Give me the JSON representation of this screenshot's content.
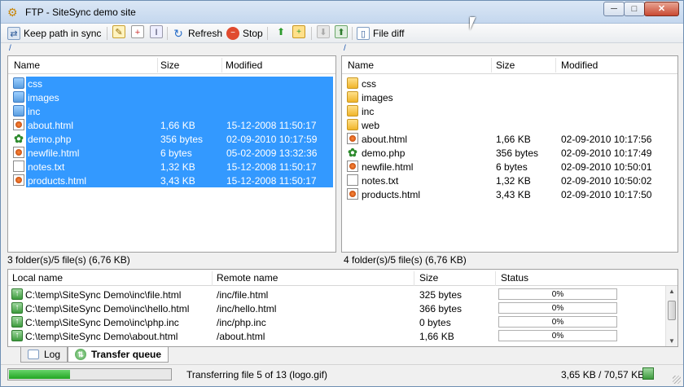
{
  "window": {
    "title": "FTP - SiteSync demo site",
    "min_glyph": "─",
    "max_glyph": "□",
    "close_glyph": "✕"
  },
  "toolbar": {
    "keep_path": "Keep path in sync",
    "refresh": "Refresh",
    "stop": "Stop",
    "file_diff": "File diff"
  },
  "left_panel": {
    "path": "/",
    "columns": [
      "Name",
      "Size",
      "Modified"
    ],
    "rows": [
      {
        "name": "css",
        "size": "",
        "modified": "",
        "type": "folder",
        "selected": true
      },
      {
        "name": "images",
        "size": "",
        "modified": "",
        "type": "folder",
        "selected": true
      },
      {
        "name": "inc",
        "size": "",
        "modified": "",
        "type": "folder",
        "selected": true
      },
      {
        "name": "about.html",
        "size": "1,66 KB",
        "modified": "15-12-2008 11:50:17",
        "type": "html",
        "selected": true
      },
      {
        "name": "demo.php",
        "size": "356 bytes",
        "modified": "02-09-2010 10:17:59",
        "type": "php",
        "selected": true
      },
      {
        "name": "newfile.html",
        "size": "6 bytes",
        "modified": "05-02-2009 13:32:36",
        "type": "html",
        "selected": true
      },
      {
        "name": "notes.txt",
        "size": "1,32 KB",
        "modified": "15-12-2008 11:50:17",
        "type": "txt",
        "selected": true
      },
      {
        "name": "products.html",
        "size": "3,43 KB",
        "modified": "15-12-2008 11:50:17",
        "type": "html",
        "selected": true
      }
    ],
    "status": "3 folder(s)/5 file(s) (6,76 KB)"
  },
  "right_panel": {
    "path": "/",
    "columns": [
      "Name",
      "Size",
      "Modified"
    ],
    "rows": [
      {
        "name": "css",
        "size": "",
        "modified": "",
        "type": "folder",
        "selected": false
      },
      {
        "name": "images",
        "size": "",
        "modified": "",
        "type": "folder",
        "selected": false
      },
      {
        "name": "inc",
        "size": "",
        "modified": "",
        "type": "folder",
        "selected": false
      },
      {
        "name": "web",
        "size": "",
        "modified": "",
        "type": "folder",
        "selected": false
      },
      {
        "name": "about.html",
        "size": "1,66 KB",
        "modified": "02-09-2010 10:17:56",
        "type": "html",
        "selected": false
      },
      {
        "name": "demo.php",
        "size": "356 bytes",
        "modified": "02-09-2010 10:17:49",
        "type": "php",
        "selected": false
      },
      {
        "name": "newfile.html",
        "size": "6 bytes",
        "modified": "02-09-2010 10:50:01",
        "type": "html",
        "selected": false
      },
      {
        "name": "notes.txt",
        "size": "1,32 KB",
        "modified": "02-09-2010 10:50:02",
        "type": "txt",
        "selected": false
      },
      {
        "name": "products.html",
        "size": "3,43 KB",
        "modified": "02-09-2010 10:17:50",
        "type": "html",
        "selected": false
      }
    ],
    "status": "4 folder(s)/5 file(s) (6,76 KB)"
  },
  "queue": {
    "columns": [
      "Local name",
      "Remote name",
      "Size",
      "Status"
    ],
    "rows": [
      {
        "local": "C:\\temp\\SiteSync Demo\\inc\\file.html",
        "remote": "/inc/file.html",
        "size": "325 bytes",
        "status": "0%",
        "progress": 0
      },
      {
        "local": "C:\\temp\\SiteSync Demo\\inc\\hello.html",
        "remote": "/inc/hello.html",
        "size": "366 bytes",
        "status": "0%",
        "progress": 0
      },
      {
        "local": "C:\\temp\\SiteSync Demo\\inc\\php.inc",
        "remote": "/inc/php.inc",
        "size": "0 bytes",
        "status": "0%",
        "progress": 0
      },
      {
        "local": "C:\\temp\\SiteSync Demo\\about.html",
        "remote": "/about.html",
        "size": "1,66 KB",
        "status": "0%",
        "progress": 0
      }
    ]
  },
  "tabs": [
    {
      "label": "Log",
      "active": false
    },
    {
      "label": "Transfer queue",
      "active": true
    }
  ],
  "statusbar": {
    "progress": 0.38,
    "message": "Transferring file 5 of 13 (logo.gif)",
    "size": "3,65 KB / 70,57 KB"
  },
  "colors": {
    "selection": "#3399ff",
    "progress": "#22a622",
    "accent": "#1a56b0"
  }
}
